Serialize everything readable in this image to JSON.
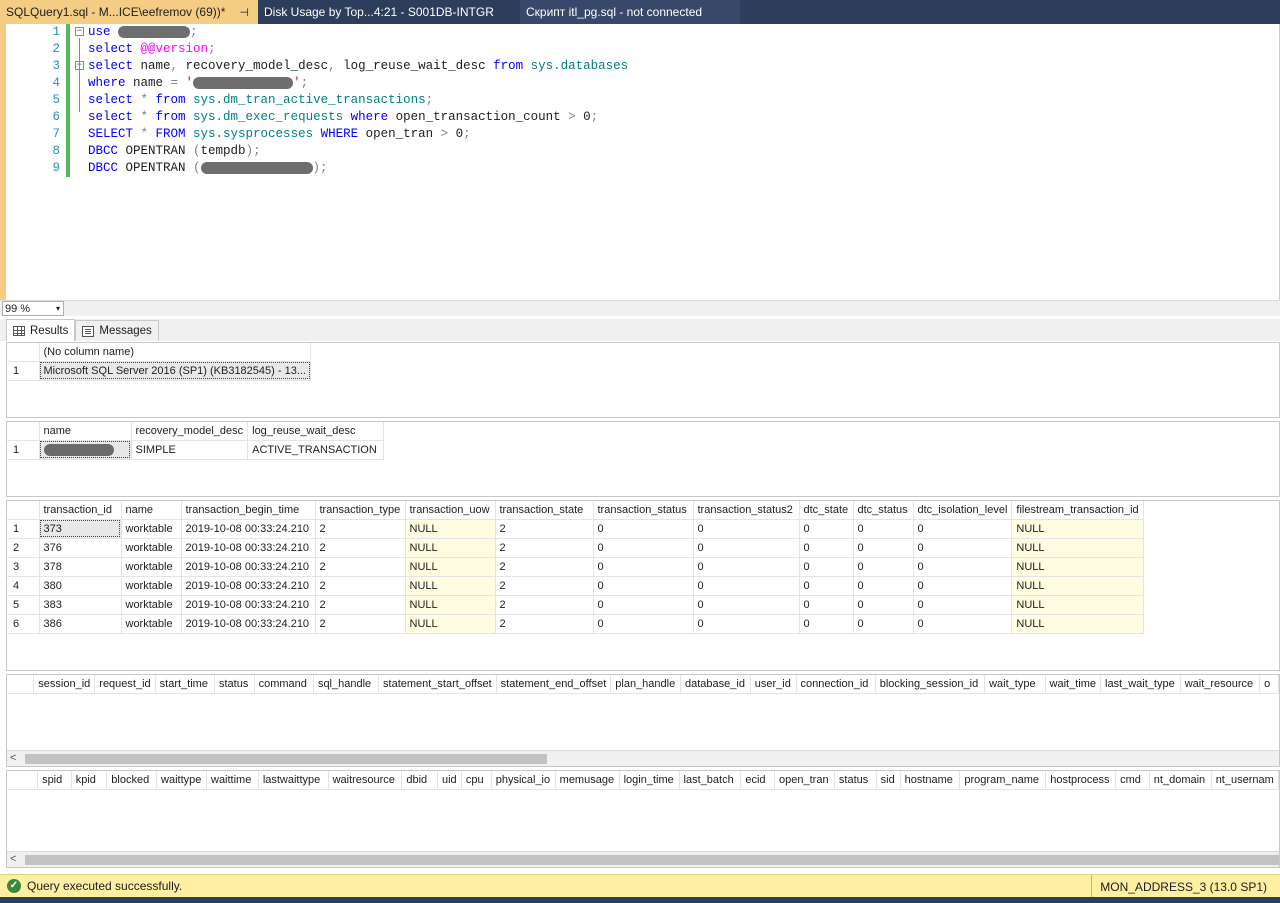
{
  "tabs": [
    {
      "label": "SQLQuery1.sql - M...ICE\\eefremov (69))*",
      "pin": "⊣",
      "close": "✕"
    },
    {
      "label": "Disk Usage by Top...4:21 - S001DB-INTGR"
    },
    {
      "label": "Скрипт itl_pg.sql - not connected"
    }
  ],
  "editor": {
    "lines": [
      {
        "n": "1",
        "parts": [
          {
            "c": "kw",
            "t": "use "
          },
          {
            "c": "redact",
            "w": 72
          },
          {
            "c": "gr",
            "t": ";"
          }
        ]
      },
      {
        "n": "2",
        "parts": [
          {
            "c": "kw",
            "t": "select "
          },
          {
            "c": "pk",
            "t": "@@version"
          },
          {
            "c": "gr",
            "t": ";"
          }
        ]
      },
      {
        "n": "3",
        "parts": [
          {
            "c": "kw",
            "t": "select "
          },
          {
            "c": "",
            "t": "name"
          },
          {
            "c": "gr",
            "t": ", "
          },
          {
            "c": "",
            "t": "recovery_model_desc"
          },
          {
            "c": "gr",
            "t": ", "
          },
          {
            "c": "",
            "t": "log_reuse_wait_desc "
          },
          {
            "c": "kw",
            "t": "from "
          },
          {
            "c": "sy",
            "t": "sys.databases"
          }
        ]
      },
      {
        "n": "4",
        "parts": [
          {
            "c": "kw",
            "t": "where "
          },
          {
            "c": "",
            "t": "name "
          },
          {
            "c": "gr",
            "t": "= "
          },
          {
            "c": "rd",
            "t": "'"
          },
          {
            "c": "redact",
            "w": 100
          },
          {
            "c": "rd",
            "t": "'"
          },
          {
            "c": "gr",
            "t": ";"
          }
        ]
      },
      {
        "n": "5",
        "parts": [
          {
            "c": "kw",
            "t": "select "
          },
          {
            "c": "gr",
            "t": "* "
          },
          {
            "c": "kw",
            "t": "from "
          },
          {
            "c": "sy",
            "t": "sys.dm_tran_active_transactions"
          },
          {
            "c": "gr",
            "t": ";"
          }
        ]
      },
      {
        "n": "6",
        "parts": [
          {
            "c": "kw",
            "t": "select "
          },
          {
            "c": "gr",
            "t": "* "
          },
          {
            "c": "kw",
            "t": "from "
          },
          {
            "c": "sy",
            "t": "sys.dm_exec_requests "
          },
          {
            "c": "kw",
            "t": "where "
          },
          {
            "c": "",
            "t": "open_transaction_count "
          },
          {
            "c": "gr",
            "t": "> "
          },
          {
            "c": "",
            "t": "0"
          },
          {
            "c": "gr",
            "t": ";"
          }
        ]
      },
      {
        "n": "7",
        "parts": [
          {
            "c": "kw",
            "t": "SELECT "
          },
          {
            "c": "gr",
            "t": "* "
          },
          {
            "c": "kw",
            "t": "FROM "
          },
          {
            "c": "sy",
            "t": "sys.sysprocesses "
          },
          {
            "c": "kw",
            "t": "WHERE "
          },
          {
            "c": "",
            "t": "open_tran "
          },
          {
            "c": "gr",
            "t": "> "
          },
          {
            "c": "",
            "t": "0"
          },
          {
            "c": "gr",
            "t": ";"
          }
        ]
      },
      {
        "n": "8",
        "parts": [
          {
            "c": "kw",
            "t": "DBCC "
          },
          {
            "c": "",
            "t": "OPENTRAN "
          },
          {
            "c": "gr",
            "t": "("
          },
          {
            "c": "",
            "t": "tempdb"
          },
          {
            "c": "gr",
            "t": ");"
          }
        ]
      },
      {
        "n": "9",
        "parts": [
          {
            "c": "kw",
            "t": "DBCC "
          },
          {
            "c": "",
            "t": "OPENTRAN "
          },
          {
            "c": "gr",
            "t": "("
          },
          {
            "c": "redact",
            "w": 112
          },
          {
            "c": "gr",
            "t": ");"
          }
        ]
      }
    ]
  },
  "zoom": {
    "value": "99 %",
    "arrow": "▾"
  },
  "results_tabs": {
    "results": "Results",
    "messages": "Messages"
  },
  "grid1": {
    "columns": [
      "(No column name)"
    ],
    "rows": [
      {
        "rn": "1",
        "cells": [
          "Microsoft SQL Server 2016 (SP1) (KB3182545) - 13..."
        ]
      }
    ]
  },
  "grid2": {
    "columns": [
      "name",
      "recovery_model_desc",
      "log_reuse_wait_desc"
    ],
    "rows": [
      {
        "rn": "1",
        "cells": [
          "",
          "SIMPLE",
          "ACTIVE_TRANSACTION"
        ]
      }
    ]
  },
  "grid3": {
    "columns": [
      "transaction_id",
      "name",
      "transaction_begin_time",
      "transaction_type",
      "transaction_uow",
      "transaction_state",
      "transaction_status",
      "transaction_status2",
      "dtc_state",
      "dtc_status",
      "dtc_isolation_level",
      "filestream_transaction_id"
    ],
    "rows": [
      {
        "rn": "1",
        "cells": [
          "373",
          "worktable",
          "2019-10-08 00:33:24.210",
          "2",
          "NULL",
          "2",
          "0",
          "0",
          "0",
          "0",
          "0",
          "NULL"
        ]
      },
      {
        "rn": "2",
        "cells": [
          "376",
          "worktable",
          "2019-10-08 00:33:24.210",
          "2",
          "NULL",
          "2",
          "0",
          "0",
          "0",
          "0",
          "0",
          "NULL"
        ]
      },
      {
        "rn": "3",
        "cells": [
          "378",
          "worktable",
          "2019-10-08 00:33:24.210",
          "2",
          "NULL",
          "2",
          "0",
          "0",
          "0",
          "0",
          "0",
          "NULL"
        ]
      },
      {
        "rn": "4",
        "cells": [
          "380",
          "worktable",
          "2019-10-08 00:33:24.210",
          "2",
          "NULL",
          "2",
          "0",
          "0",
          "0",
          "0",
          "0",
          "NULL"
        ]
      },
      {
        "rn": "5",
        "cells": [
          "383",
          "worktable",
          "2019-10-08 00:33:24.210",
          "2",
          "NULL",
          "2",
          "0",
          "0",
          "0",
          "0",
          "0",
          "NULL"
        ]
      },
      {
        "rn": "6",
        "cells": [
          "386",
          "worktable",
          "2019-10-08 00:33:24.210",
          "2",
          "NULL",
          "2",
          "0",
          "0",
          "0",
          "0",
          "0",
          "NULL"
        ]
      }
    ]
  },
  "grid4": {
    "columns": [
      "session_id",
      "request_id",
      "start_time",
      "status",
      "command",
      "sql_handle",
      "statement_start_offset",
      "statement_end_offset",
      "plan_handle",
      "database_id",
      "user_id",
      "connection_id",
      "blocking_session_id",
      "wait_type",
      "wait_time",
      "last_wait_type",
      "wait_resource",
      "o"
    ]
  },
  "grid5": {
    "columns": [
      "spid",
      "kpid",
      "blocked",
      "waittype",
      "waittime",
      "lastwaittype",
      "waitresource",
      "dbid",
      "uid",
      "cpu",
      "physical_io",
      "memusage",
      "login_time",
      "last_batch",
      "ecid",
      "open_tran",
      "status",
      "sid",
      "hostname",
      "program_name",
      "hostprocess",
      "cmd",
      "nt_domain",
      "nt_usernam"
    ]
  },
  "scroll_arrow": "<",
  "status": {
    "icon": "✓",
    "text": "Query executed successfully.",
    "server": "MON_ADDRESS_3 (13.0 SP1)"
  }
}
